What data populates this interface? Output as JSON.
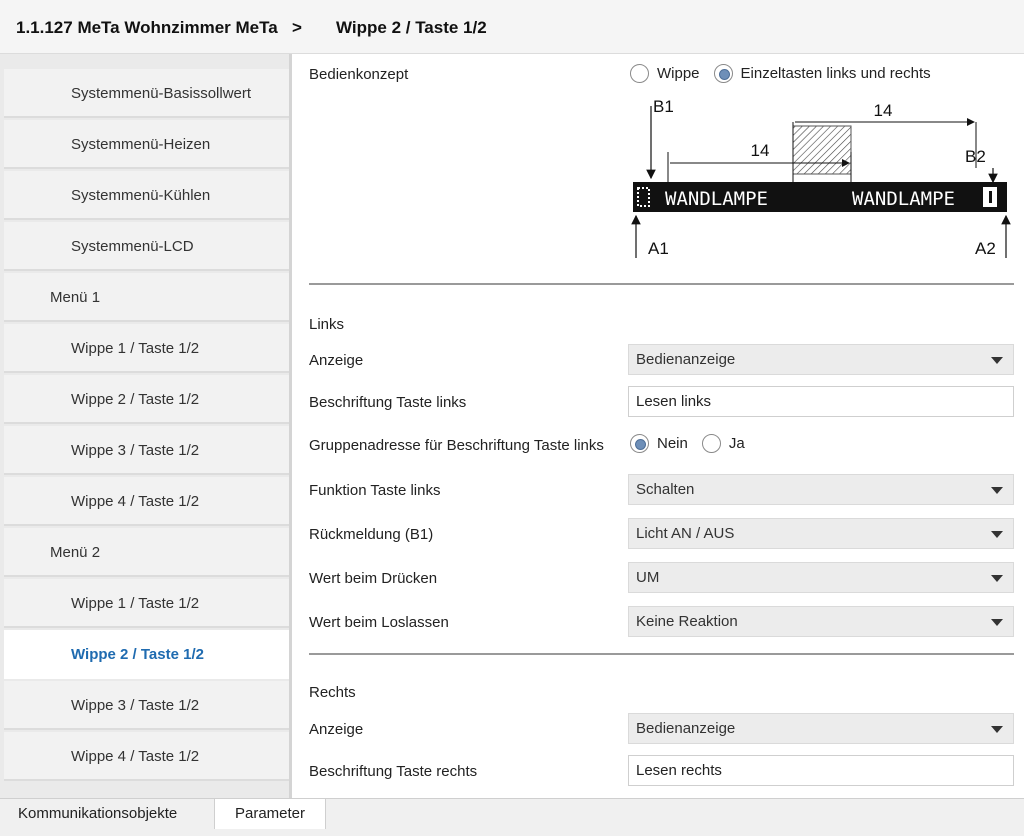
{
  "header": {
    "breadcrumb_root": "1.1.127 MeTa Wohnzimmer MeTa",
    "separator": ">",
    "current": "Wippe 2 / Taste 1/2"
  },
  "sidebar": {
    "items": [
      {
        "label": "Systemmenü-Basissollwert"
      },
      {
        "label": "Systemmenü-Heizen"
      },
      {
        "label": "Systemmenü-Kühlen"
      },
      {
        "label": "Systemmenü-LCD"
      },
      {
        "label": "Menü 1"
      },
      {
        "label": "Wippe 1 / Taste 1/2"
      },
      {
        "label": "Wippe 2 / Taste 1/2"
      },
      {
        "label": "Wippe 3 / Taste 1/2"
      },
      {
        "label": "Wippe 4 / Taste 1/2"
      },
      {
        "label": "Menü 2"
      },
      {
        "label": "Wippe 1 / Taste 1/2"
      },
      {
        "label": "Wippe 2 / Taste 1/2",
        "active": true
      },
      {
        "label": "Wippe 3 / Taste 1/2"
      },
      {
        "label": "Wippe 4 / Taste 1/2"
      }
    ]
  },
  "bedienkonzept": {
    "label": "Bedienkonzept",
    "options": [
      "Wippe",
      "Einzeltasten links und rechts"
    ],
    "selected": "Einzeltasten links und rechts"
  },
  "diagram": {
    "label_b1": "B1",
    "label_b2": "B2",
    "label_a1": "A1",
    "label_a2": "A2",
    "dim_top": "14",
    "dim_left": "14",
    "display_left": "WANDLAMPE",
    "display_right": "WANDLAMPE"
  },
  "links": {
    "title": "Links",
    "anzeige_label": "Anzeige",
    "anzeige_value": "Bedienanzeige",
    "beschriftung_label": "Beschriftung Taste links",
    "beschriftung_value": "Lesen links",
    "gruppenadresse_label": "Gruppenadresse für Beschriftung Taste links",
    "gruppenadresse_options": [
      "Nein",
      "Ja"
    ],
    "gruppenadresse_selected": "Nein",
    "funktion_label": "Funktion Taste links",
    "funktion_value": "Schalten",
    "rueckmeldung_label": "Rückmeldung (B1)",
    "rueckmeldung_value": "Licht AN / AUS",
    "druecken_label": "Wert beim Drücken",
    "druecken_value": "UM",
    "loslassen_label": "Wert beim Loslassen",
    "loslassen_value": "Keine Reaktion"
  },
  "rechts": {
    "title": "Rechts",
    "anzeige_label": "Anzeige",
    "anzeige_value": "Bedienanzeige",
    "beschriftung_label": "Beschriftung Taste rechts",
    "beschriftung_value": "Lesen rechts"
  },
  "tabs": {
    "kommunikation": "Kommunikationsobjekte",
    "parameter": "Parameter",
    "active": "Parameter"
  }
}
